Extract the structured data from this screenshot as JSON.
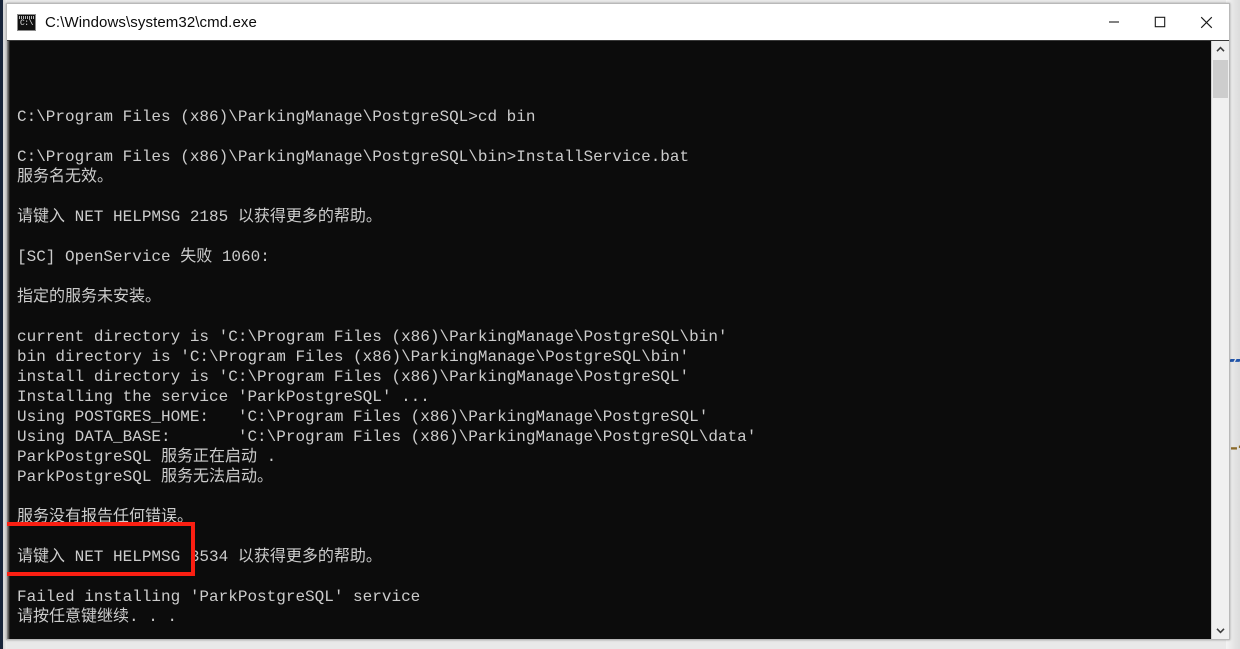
{
  "window": {
    "title": "C:\\Windows\\system32\\cmd.exe",
    "icon": "cmd-console-icon",
    "icon_text": "C:\\",
    "controls": {
      "minimize_label": "Minimize",
      "maximize_label": "Maximize",
      "close_label": "Close"
    },
    "colors": {
      "console_background": "#0c0c0c",
      "console_text": "#cccccc",
      "title_bar_background": "#ffffff",
      "annotation_red": "#fb1f12"
    }
  },
  "console": {
    "lines": [
      "C:\\Program Files (x86)\\ParkingManage\\PostgreSQL>cd bin",
      "",
      "C:\\Program Files (x86)\\ParkingManage\\PostgreSQL\\bin>InstallService.bat",
      "服务名无效。",
      "",
      "请键入 NET HELPMSG 2185 以获得更多的帮助。",
      "",
      "[SC] OpenService 失败 1060:",
      "",
      "指定的服务未安装。",
      "",
      "current directory is 'C:\\Program Files (x86)\\ParkingManage\\PostgreSQL\\bin'",
      "bin directory is 'C:\\Program Files (x86)\\ParkingManage\\PostgreSQL\\bin'",
      "install directory is 'C:\\Program Files (x86)\\ParkingManage\\PostgreSQL'",
      "Installing the service 'ParkPostgreSQL' ...",
      "Using POSTGRES_HOME:   'C:\\Program Files (x86)\\ParkingManage\\PostgreSQL'",
      "Using DATA_BASE:       'C:\\Program Files (x86)\\ParkingManage\\PostgreSQL\\data'",
      "ParkPostgreSQL 服务正在启动 .",
      "ParkPostgreSQL 服务无法启动。",
      "",
      "服务没有报告任何错误。",
      "",
      "请键入 NET HELPMSG 3534 以获得更多的帮助。",
      "",
      "Failed installing 'ParkPostgreSQL' service",
      "请按任意键继续. . ."
    ]
  },
  "annotation": {
    "name": "red-highlight-box",
    "highlighted_text": "Failed installing\n请按任意键继续. . ."
  },
  "scrollbar": {
    "up_label": "Scroll up",
    "down_label": "Scroll down",
    "thumb_label": "Scroll thumb"
  },
  "background": {
    "artifact_1": "▰▰",
    "artifact_2": "▬▪"
  }
}
